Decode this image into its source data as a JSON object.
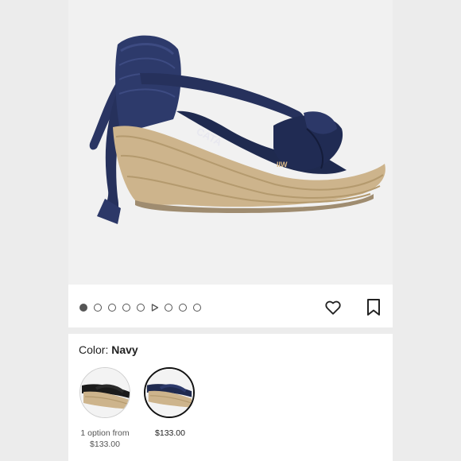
{
  "product": {
    "image_alt": "Navy espadrille wedge sandal with ankle ties",
    "brand_mark_text": "CATA",
    "insole_logo": "IIW",
    "colors": {
      "navy": "#1f2a4f",
      "jute": "#cdb48c",
      "background": "#f1f1f1"
    }
  },
  "gallery": {
    "dot_count": 10,
    "active_index": 0,
    "video_index": 5
  },
  "actions": {
    "like_icon": "heart-icon",
    "save_icon": "bookmark-icon"
  },
  "color_selector": {
    "label": "Color:",
    "selected": "Navy",
    "options": [
      {
        "name": "Black",
        "caption": "1 option from\n$133.00",
        "caption_line1": "1 option from",
        "caption_line2": "$133.00"
      },
      {
        "name": "Navy",
        "caption": "$133.00"
      }
    ]
  }
}
